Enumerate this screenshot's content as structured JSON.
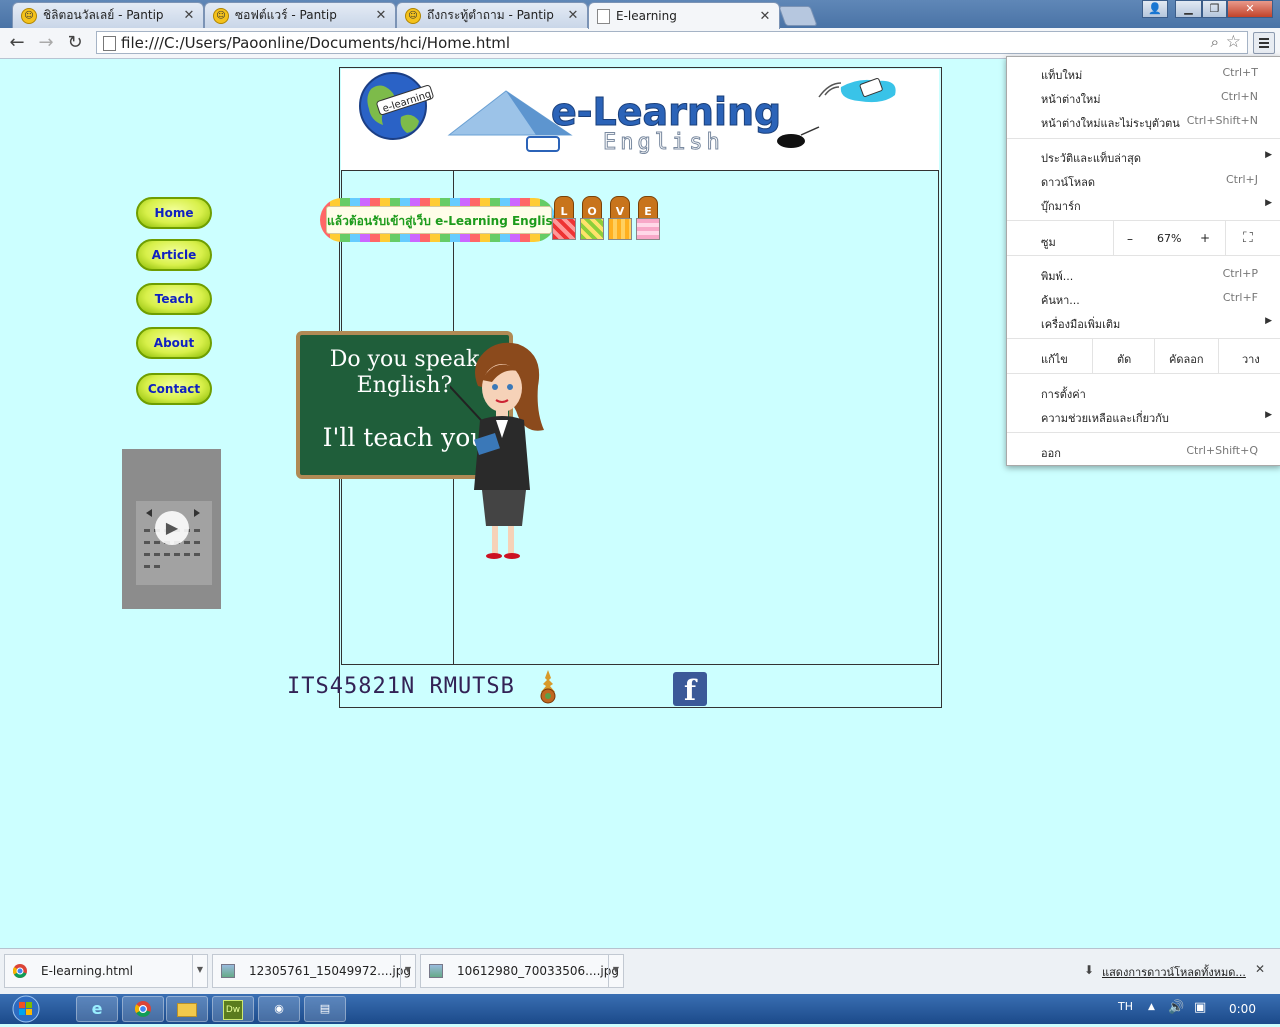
{
  "browser": {
    "tabs": [
      {
        "title": "ชิลิตอนวัลเลย์ - Pantip",
        "active": false
      },
      {
        "title": "ซอฟต์แวร์ - Pantip",
        "active": false
      },
      {
        "title": "ถึงกระทู้ตำถาม - Pantip",
        "active": false
      },
      {
        "title": "E-learning",
        "active": true
      }
    ],
    "url": "file:///C:/Users/Paoonline/Documents/hci/Home.html"
  },
  "page": {
    "nav": [
      {
        "label": "Home"
      },
      {
        "label": "Article"
      },
      {
        "label": "Teach"
      },
      {
        "label": "About"
      },
      {
        "label": "Contact"
      }
    ],
    "banner": {
      "title": "e-Learning",
      "subtitle": "English",
      "globe_label": "e-learning"
    },
    "marquee": "แล้วต้อนรับเข้าสู่เว็บ e-Learning English",
    "love_letters": [
      "L",
      "O",
      "V",
      "E"
    ],
    "board": {
      "line1": "Do you speak",
      "line2": "English?",
      "line3": "I'll teach you"
    },
    "footer": {
      "text": "ITS45821N  RMUTSB"
    }
  },
  "menu": {
    "items": [
      {
        "label": "แท็บใหม่",
        "shortcut": "Ctrl+T"
      },
      {
        "label": "หน้าต่างใหม่",
        "shortcut": "Ctrl+N"
      },
      {
        "label": "หน้าต่างใหม่และไม่ระบุตัวตน",
        "shortcut": "Ctrl+Shift+N"
      },
      {
        "label": "ประวัติและแท็บล่าสุด",
        "shortcut": ""
      },
      {
        "label": "ดาวน์โหลด",
        "shortcut": "Ctrl+J"
      },
      {
        "label": "บุ๊กมาร์ก",
        "shortcut": ""
      },
      {
        "label": "พิมพ์...",
        "shortcut": "Ctrl+P"
      },
      {
        "label": "ค้นหา...",
        "shortcut": "Ctrl+F"
      },
      {
        "label": "เครื่องมือเพิ่มเติม",
        "shortcut": ""
      },
      {
        "label": "การตั้งค่า",
        "shortcut": ""
      },
      {
        "label": "ความช่วยเหลือและเกี่ยวกับ",
        "shortcut": ""
      },
      {
        "label": "ออก",
        "shortcut": "Ctrl+Shift+Q"
      }
    ],
    "zoom": {
      "label": "ซูม",
      "minus": "–",
      "value": "67%",
      "plus": "+"
    },
    "edit": {
      "label": "แก้ไข",
      "cut": "ตัด",
      "copy": "คัดลอก",
      "paste": "วาง"
    }
  },
  "downloads": {
    "items": [
      {
        "name": "E-learning.html"
      },
      {
        "name": "12305761_15049972....jpg"
      },
      {
        "name": "10612980_70033506....jpg"
      }
    ],
    "show_all": "แสดงการดาวน์โหลดทั้งหมด..."
  },
  "taskbar": {
    "lang": "TH",
    "clock": "0:00",
    "dw_label": "Dw"
  }
}
